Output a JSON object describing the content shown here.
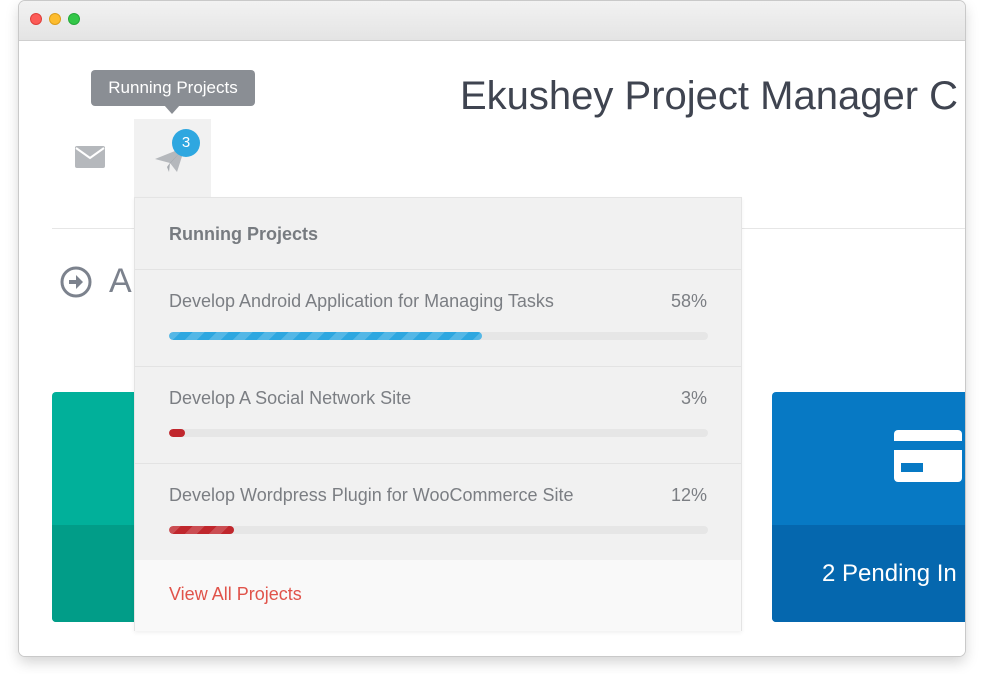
{
  "window": {
    "controls": [
      "close",
      "minimize",
      "maximize"
    ]
  },
  "header": {
    "title": "Ekushey Project Manager C",
    "tooltip": "Running Projects",
    "badge_count": "3"
  },
  "nav": [
    {
      "icon": "mail-icon"
    },
    {
      "icon": "paper-plane-icon",
      "active": true
    }
  ],
  "section": {
    "icon": "arrow-circle-right-icon",
    "title": "A"
  },
  "dropdown": {
    "header": "Running Projects",
    "items": [
      {
        "name": "Develop Android Application for Managing Tasks",
        "percent_label": "58%",
        "progress": 58,
        "color": "#2ea7e0",
        "striped": true
      },
      {
        "name": "Develop A Social Network Site",
        "percent_label": "3%",
        "progress": 3,
        "color": "#c0272d",
        "striped": false
      },
      {
        "name": "Develop Wordpress Plugin for WooCommerce Site",
        "percent_label": "12%",
        "progress": 12,
        "color": "#c0272d",
        "striped": true
      }
    ],
    "footer_link": "View All Projects"
  },
  "cards": [
    {
      "color": "#01b09a",
      "label": ""
    },
    {
      "color": "#0779c4",
      "icon": "credit-card-icon",
      "label": "2 Pending In"
    }
  ],
  "colors": {
    "accent": "#2ea7e0",
    "danger": "#c0272d",
    "link": "#e0534a"
  }
}
